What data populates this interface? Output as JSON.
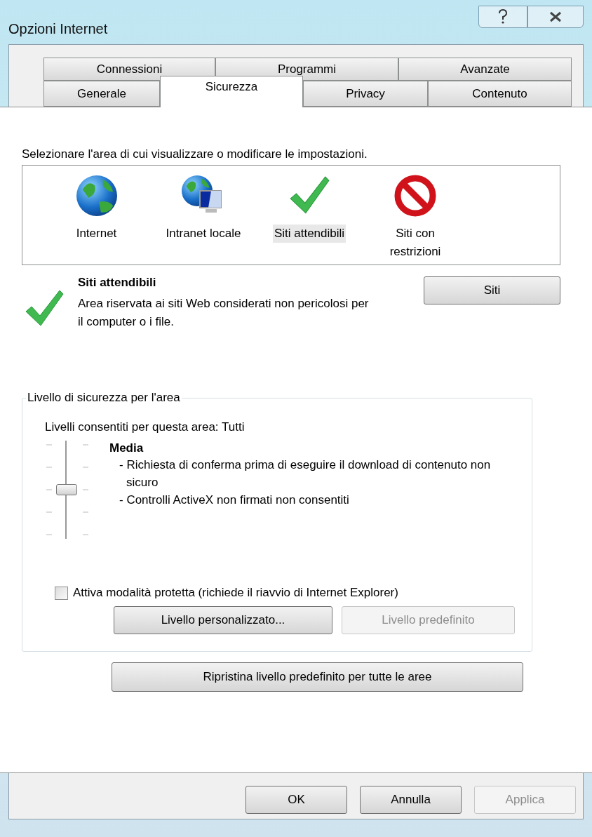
{
  "window": {
    "title": "Opzioni Internet"
  },
  "tab_rows": [
    [
      {
        "label": "Connessioni",
        "selected": false
      },
      {
        "label": "Programmi",
        "selected": false
      },
      {
        "label": "Avanzate",
        "selected": false
      }
    ],
    [
      {
        "label": "Generale",
        "selected": false
      },
      {
        "label": "Sicurezza",
        "selected": true
      },
      {
        "label": "Privacy",
        "selected": false
      },
      {
        "label": "Contenuto",
        "selected": false
      }
    ]
  ],
  "zone_prompt": "Selezionare l'area di cui visualizzare o modificare le impostazioni.",
  "zones": [
    {
      "kind": "globe",
      "label": "Internet",
      "selected": false
    },
    {
      "kind": "intranet",
      "label": "Intranet locale",
      "selected": false
    },
    {
      "kind": "check",
      "label": "Siti attendibili",
      "selected": true
    },
    {
      "kind": "blocked",
      "label": "Siti con restrizioni",
      "selected": false
    }
  ],
  "zone_details": {
    "kind": "check",
    "title": "Siti attendibili",
    "description": "Area riservata ai siti Web considerati non pericolosi per il computer o i file.",
    "button": "Siti"
  },
  "security_level": {
    "legend": "Livello di sicurezza per l'area",
    "allowed": "Livelli consentiti per questa area: Tutti",
    "slider": {
      "level": 0.5
    },
    "name": "Media",
    "points": [
      "- Richiesta di conferma prima di eseguire il download di contenuto non sicuro",
      "- Controlli ActiveX non firmati non consentiti"
    ],
    "protected_mode": {
      "label": "Attiva modalità protetta (richiede il riavvio di Internet Explorer)",
      "checked": false
    },
    "buttons": [
      {
        "label": "Livello personalizzato...",
        "disabled": false
      },
      {
        "label": "Livello predefinito",
        "disabled": true
      }
    ]
  },
  "reset_button": {
    "label": "Ripristina livello predefinito per tutte le aree",
    "disabled": false
  },
  "footer_buttons": [
    {
      "label": "OK",
      "disabled": false
    },
    {
      "label": "Annulla",
      "disabled": false
    },
    {
      "label": "Applica",
      "disabled": true
    }
  ]
}
